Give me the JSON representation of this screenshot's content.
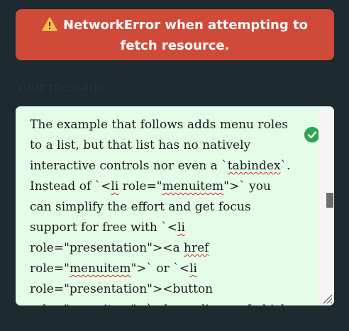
{
  "error": {
    "icon": "warning-icon",
    "message": "NetworkError when attempting to fetch resource."
  },
  "form": {
    "label": "Your message",
    "textarea": {
      "segments": [
        {
          "t": "The example that follows adds menu roles to a list, but that list has no natively interactive controls nor even a `",
          "s": false
        },
        {
          "t": "tabindex",
          "s": true
        },
        {
          "t": "`. Instead of `<",
          "s": false
        },
        {
          "t": "li",
          "s": true
        },
        {
          "t": " role=\"",
          "s": false
        },
        {
          "t": "menuitem",
          "s": true
        },
        {
          "t": "\">` you can simplify the effort and get focus support for free with `<",
          "s": false
        },
        {
          "t": "li",
          "s": true
        },
        {
          "t": " role=\"presentation\"><a ",
          "s": false
        },
        {
          "t": "href",
          "s": true
        },
        {
          "t": " role=\"",
          "s": false
        },
        {
          "t": "menuitem",
          "s": true
        },
        {
          "t": "\">` or `<",
          "s": false
        },
        {
          "t": "li",
          "s": true
        },
        {
          "t": " role=\"presentation\"><button role=\"",
          "s": false
        },
        {
          "t": "menuitem",
          "s": true
        },
        {
          "t": "\">`, depending on [which hook would obviously be at](https://",
          "s": false
        }
      ],
      "valid_icon": "check-circle-icon"
    }
  },
  "colors": {
    "background": "#1d2a30",
    "error": "#d04a3a",
    "textarea_bg": "#e4fde9",
    "valid": "#2ea44f",
    "spell_error": "#e02020"
  }
}
